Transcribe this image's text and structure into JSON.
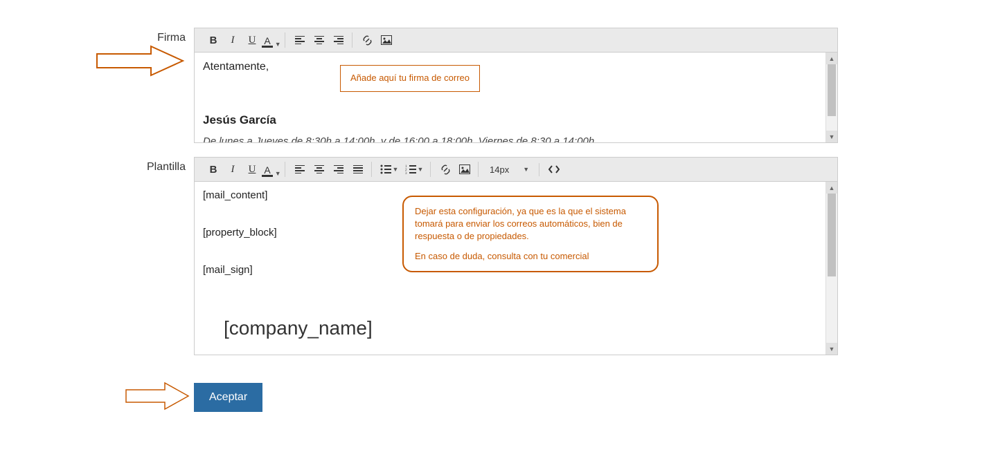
{
  "labels": {
    "firma": "Firma",
    "plantilla": "Plantilla"
  },
  "signature": {
    "greeting": "Atentamente,",
    "name": "Jesús García",
    "hours": "De lunes a Jueves de 8:30h a 14:00h, y de 16:00 a 18:00h. Viernes de 8:30 a 14:00h."
  },
  "template": {
    "line1": "[mail_content]",
    "line2": "[property_block]",
    "line3": "[mail_sign]",
    "company": "[company_name]"
  },
  "callouts": {
    "c1": "Añade aquí tu firma de correo",
    "c2_p1": "Dejar esta configuración, ya que es la que el sistema tomará para enviar los correos automáticos, bien de respuesta o de propiedades.",
    "c2_p2": "En caso de duda, consulta con tu comercial"
  },
  "toolbar": {
    "fontsize": "14px"
  },
  "buttons": {
    "accept": "Aceptar"
  }
}
